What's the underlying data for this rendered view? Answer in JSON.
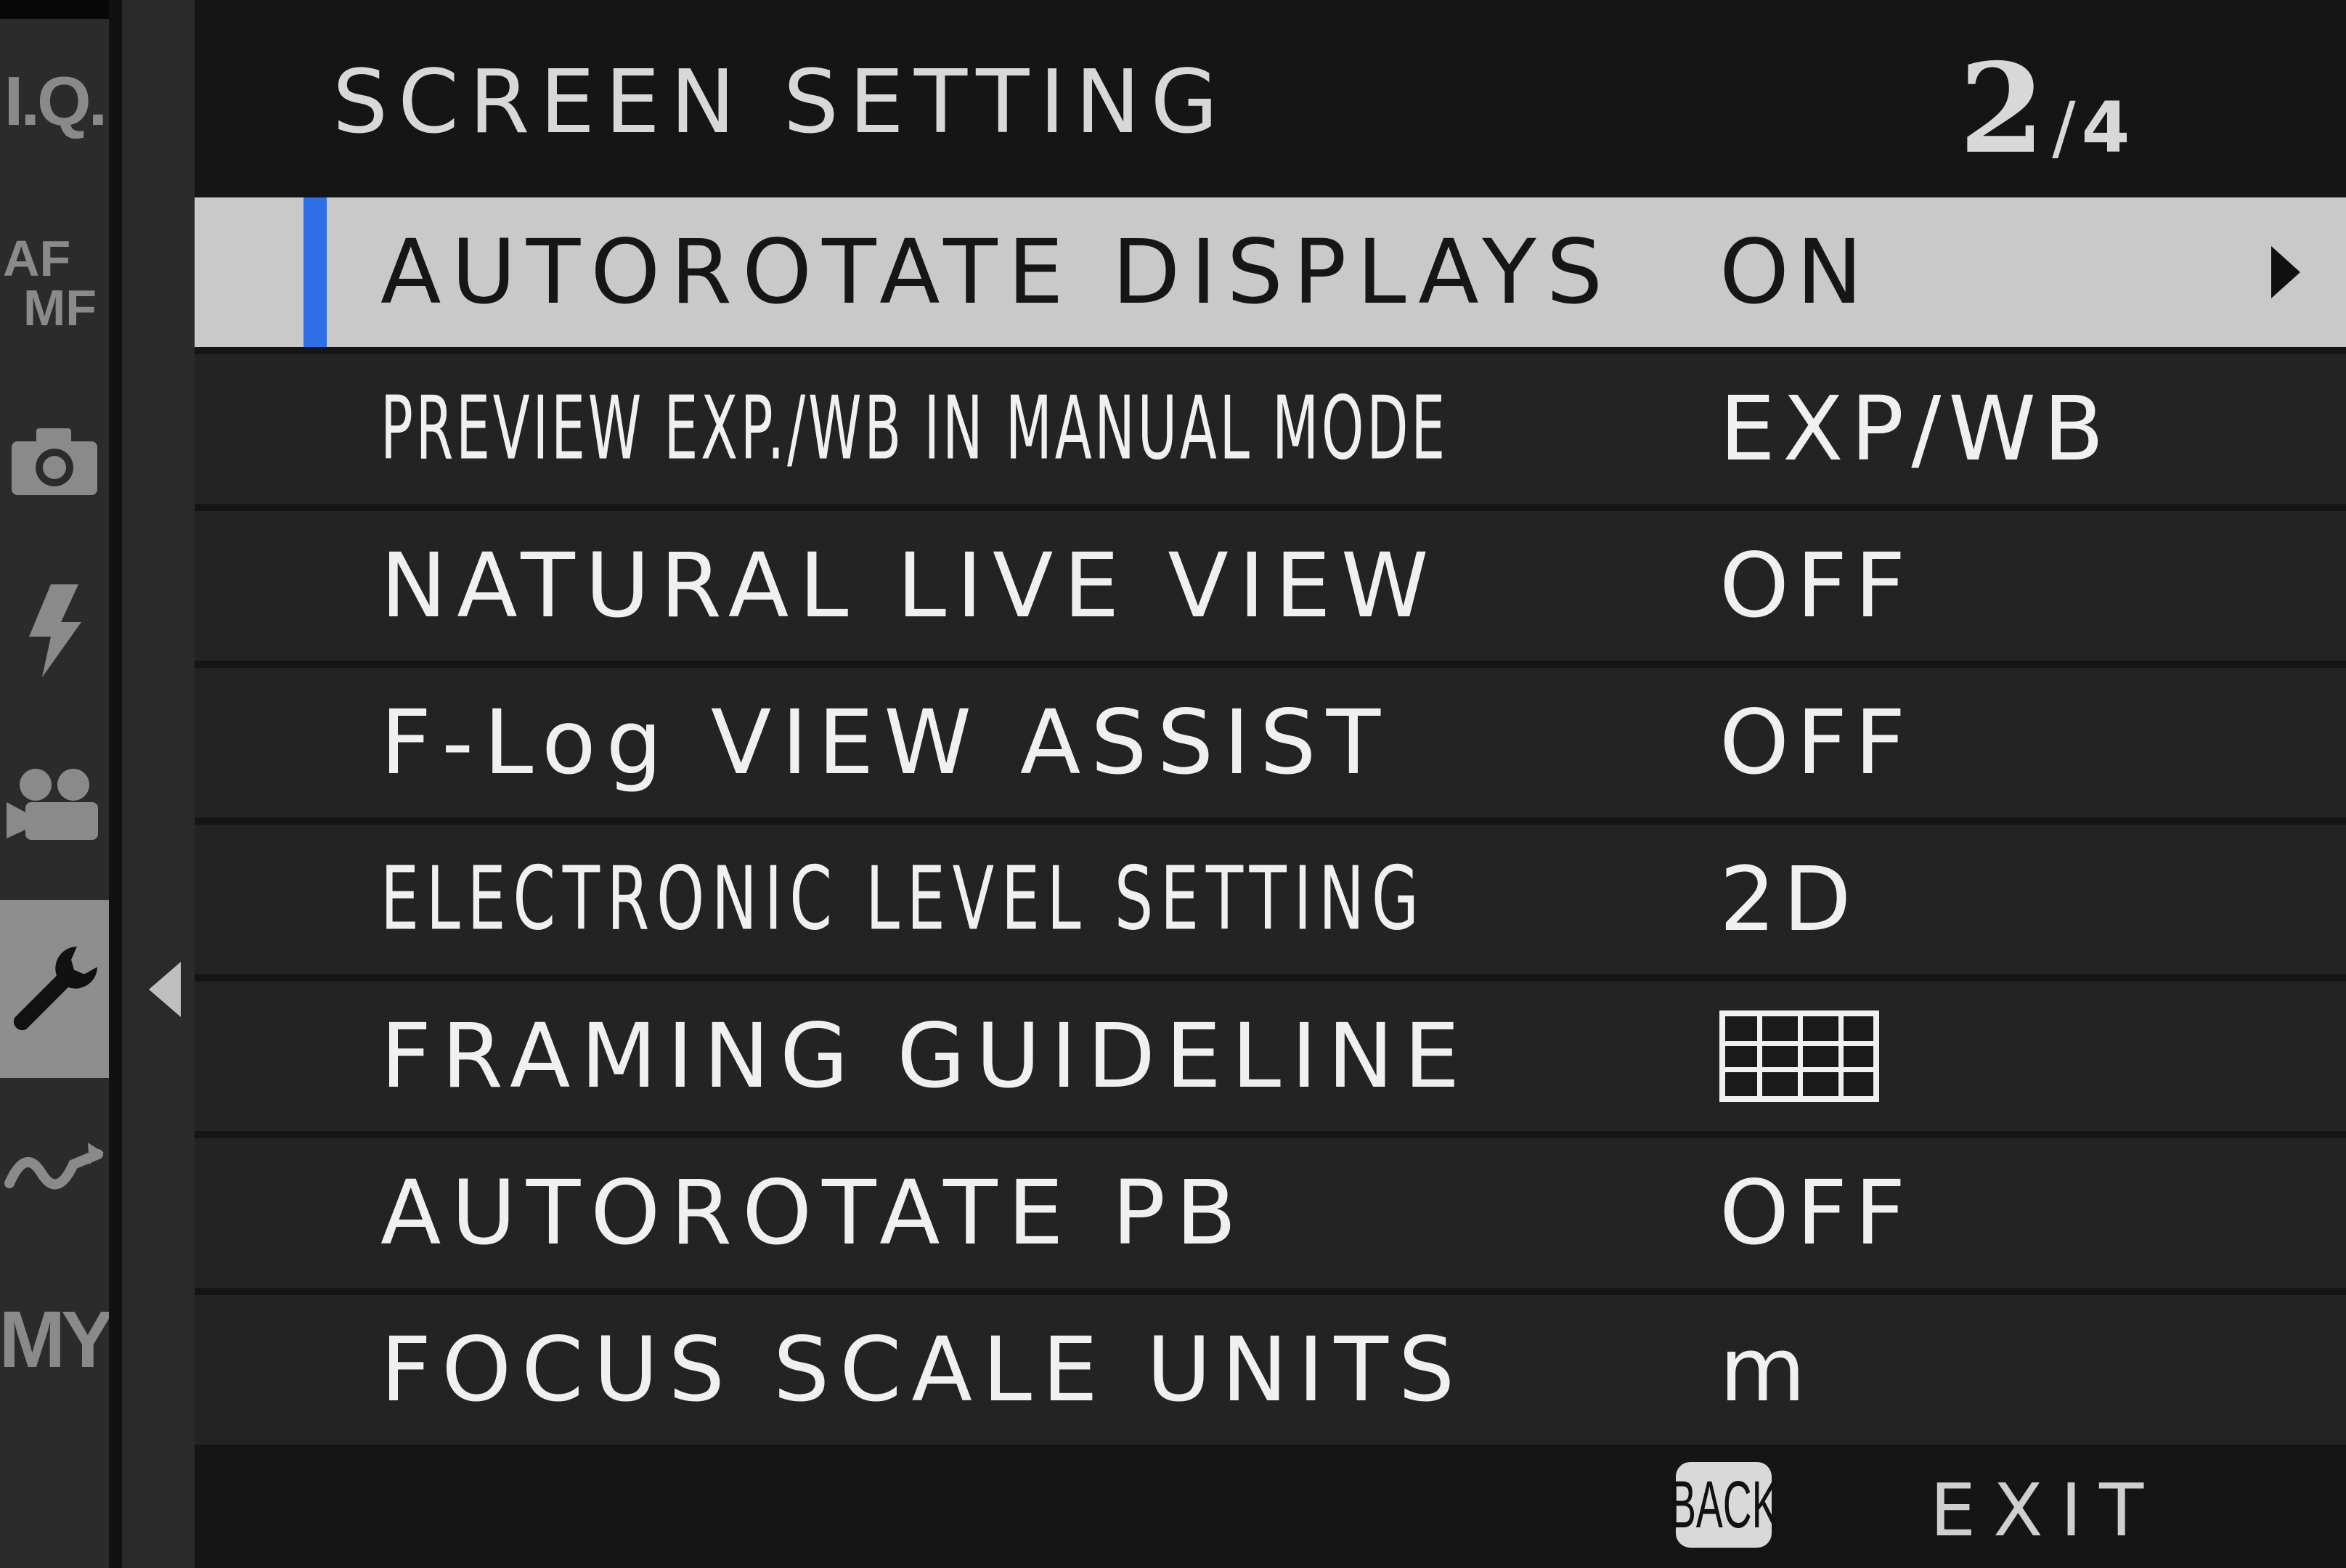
{
  "tabs": [
    {
      "label": "I.Q.",
      "icon": "image-quality-icon"
    },
    {
      "label": "AF MF",
      "icon": "af-mf-icon"
    },
    {
      "label": "",
      "icon": "camera-icon"
    },
    {
      "label": "",
      "icon": "flash-icon"
    },
    {
      "label": "",
      "icon": "movie-camera-icon"
    },
    {
      "label": "",
      "icon": "wrench-icon",
      "active": true
    },
    {
      "label": "",
      "icon": "custom-wave-icon"
    },
    {
      "label": "MY",
      "icon": "my-menu-icon"
    }
  ],
  "header": {
    "title": "SCREEN SETTING",
    "page_current": "2",
    "page_separator": "/",
    "page_total": "4"
  },
  "items": [
    {
      "label": "AUTOROTATE DISPLAYS",
      "value": "ON",
      "selected": true
    },
    {
      "label": "PREVIEW EXP./WB IN MANUAL MODE",
      "value": "EXP/WB"
    },
    {
      "label": "NATURAL LIVE VIEW",
      "value": "OFF"
    },
    {
      "label": "F-Log VIEW ASSIST",
      "value": "OFF"
    },
    {
      "label": "ELECTRONIC LEVEL SETTING",
      "value": "2D"
    },
    {
      "label": "FRAMING GUIDELINE",
      "value_icon": "framing-grid-icon"
    },
    {
      "label": "AUTOROTATE PB",
      "value": "OFF"
    },
    {
      "label": "FOCUS SCALE UNITS",
      "value": "m"
    }
  ],
  "footer": {
    "back_label": "BACK",
    "exit_label": "EXIT"
  },
  "colors": {
    "selection_accent": "#2f6fe8",
    "selected_row_bg": "#c9c9c9",
    "row_bg": "#232323"
  }
}
